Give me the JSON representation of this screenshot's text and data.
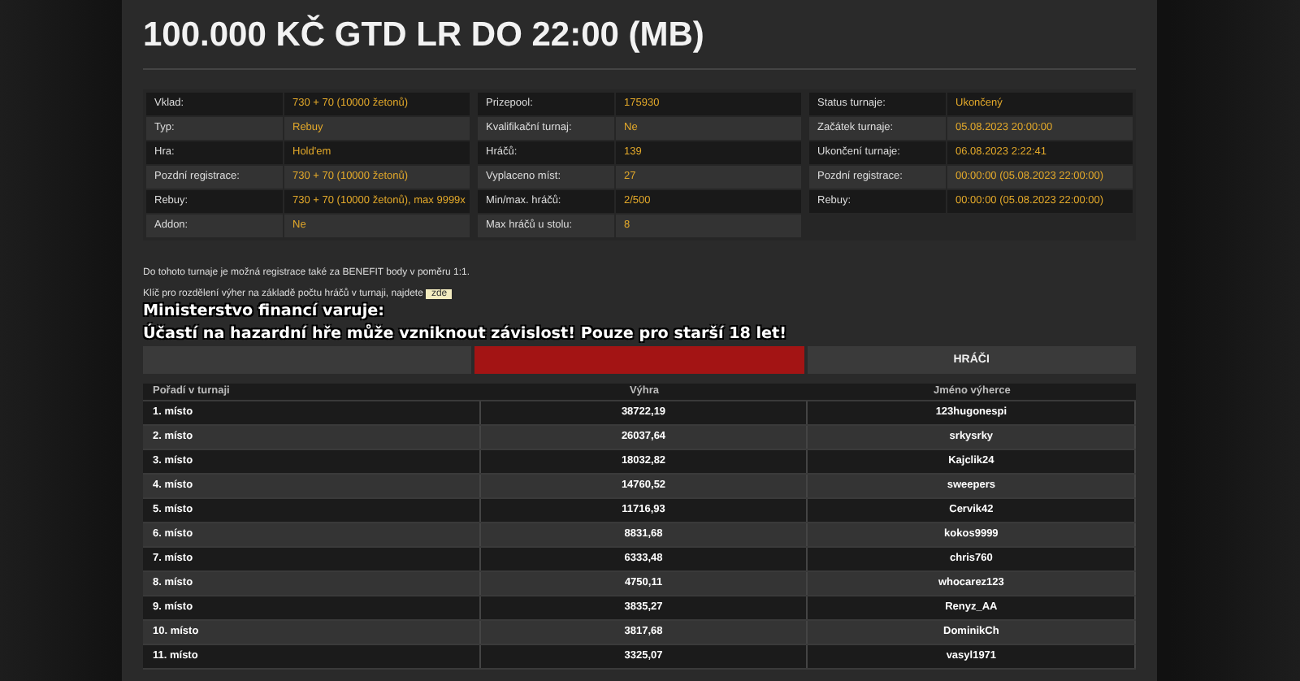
{
  "title": "100.000 KČ GTD LR DO 22:00 (MB)",
  "info_tables": [
    {
      "rows": [
        {
          "label": "Vklad:",
          "value": "730 + 70 (10000 žetonů)"
        },
        {
          "label": "Typ:",
          "value": "Rebuy"
        },
        {
          "label": "Hra:",
          "value": "Hold'em"
        },
        {
          "label": "Pozdní registrace:",
          "value": "730 + 70 (10000 žetonů)"
        },
        {
          "label": "Rebuy:",
          "value": "730 + 70 (10000 žetonů), max 9999x"
        },
        {
          "label": "Addon:",
          "value": "Ne"
        }
      ]
    },
    {
      "rows": [
        {
          "label": "Prizepool:",
          "value": "175930"
        },
        {
          "label": "Kvalifikační turnaj:",
          "value": "Ne"
        },
        {
          "label": "Hráčů:",
          "value": "139"
        },
        {
          "label": "Vyplaceno míst:",
          "value": "27"
        },
        {
          "label": "Min/max. hráčů:",
          "value": "2/500"
        },
        {
          "label": "Max hráčů u stolu:",
          "value": "8"
        }
      ]
    },
    {
      "rows": [
        {
          "label": "Status turnaje:",
          "value": "Ukončený"
        },
        {
          "label": "Začátek turnaje:",
          "value": "05.08.2023 20:00:00"
        },
        {
          "label": "Ukončení turnaje:",
          "value": "06.08.2023 2:22:41"
        },
        {
          "label": "Pozdní registrace:",
          "value": "00:00:00 (05.08.2023 22:00:00)"
        },
        {
          "label": "Rebuy:",
          "value": "00:00:00 (05.08.2023 22:00:00)"
        }
      ]
    }
  ],
  "notes": [
    {
      "text": "Do tohoto turnaje je možná registrace také za BENEFIT body v poměru 1:1."
    },
    {
      "text": "Klíč pro rozdělení výher na základě počtu hráčů v turnaji, najdete",
      "link": "zde"
    }
  ],
  "warning": [
    "Ministerstvo financí varuje:",
    "Účastí na hazardní hře může vzniknout závislost! Pouze pro starší 18 let!"
  ],
  "tabs": [
    {
      "selected": false
    },
    {
      "selected": true
    },
    {
      "label": "HRÁČI",
      "selected": false
    }
  ],
  "table": {
    "columns": [
      "Pořadí v turnaji",
      "Výhra",
      "Jméno výherce"
    ],
    "rows": [
      [
        "1. místo",
        "38722,19",
        "123hugonespi"
      ],
      [
        "2. místo",
        "26037,64",
        "srkysrky"
      ],
      [
        "3. místo",
        "18032,82",
        "Kajclik24"
      ],
      [
        "4. místo",
        "14760,52",
        "sweepers"
      ],
      [
        "5. místo",
        "11716,93",
        "Cervik42"
      ],
      [
        "6. místo",
        "8831,68",
        "kokos9999"
      ],
      [
        "7. místo",
        "6333,48",
        "chris760"
      ],
      [
        "8. místo",
        "4750,11",
        "whocarez123"
      ],
      [
        "9. místo",
        "3835,27",
        "Renyz_AA"
      ],
      [
        "10. místo",
        "3817,68",
        "DominikCh"
      ],
      [
        "11. místo",
        "3325,07",
        "vasyl1971"
      ]
    ]
  }
}
